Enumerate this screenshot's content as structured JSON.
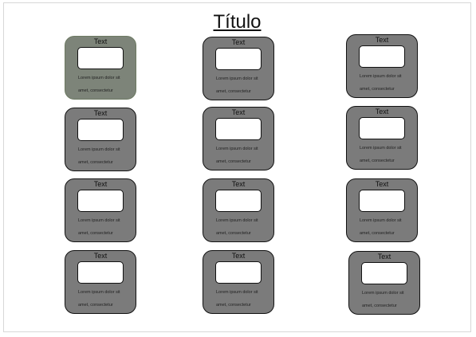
{
  "page": {
    "title": "Título"
  },
  "cards": [
    {
      "title": "Text",
      "body": "Lorem ipsum dolor sit amet, consectetur"
    },
    {
      "title": "Text",
      "body": "Lorem ipsum dolor sit amet, consectetur"
    },
    {
      "title": "Text",
      "body": "Lorem ipsum dolor sit amet, consectetur"
    },
    {
      "title": "Text",
      "body": "Lorem ipsum dolor sit amet, consectetur"
    },
    {
      "title": "Text",
      "body": "Lorem ipsum dolor sit amet, consectetur"
    },
    {
      "title": "Text",
      "body": "Lorem ipsum dolor sit amet, consectetur"
    },
    {
      "title": "Text",
      "body": "Lorem ipsum dolor sit amet, consectetur"
    },
    {
      "title": "Text",
      "body": "Lorem ipsum dolor sit amet, consectetur"
    },
    {
      "title": "Text",
      "body": "Lorem ipsum dolor sit amet, consectetur"
    },
    {
      "title": "Text",
      "body": "Lorem ipsum dolor sit amet, consectetur"
    },
    {
      "title": "Text",
      "body": "Lorem ipsum dolor sit amet, consectetur"
    },
    {
      "title": "Text",
      "body": "Lorem ipsum dolor sit amet, consectetur"
    }
  ]
}
